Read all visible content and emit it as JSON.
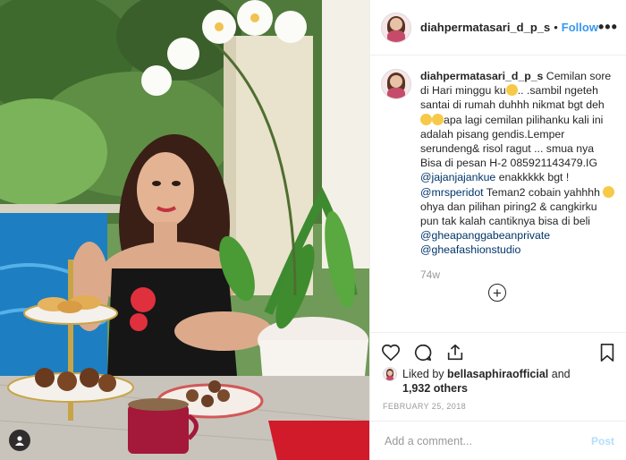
{
  "post": {
    "username": "diahpermatasari_d_p_s",
    "follow_label": "Follow",
    "dot": "•",
    "more_label": "•••"
  },
  "caption": {
    "username": "diahpermatasari_d_p_s",
    "part1": " Cemilan sore di Hari minggu ku",
    "part2": ".. .sambil ngeteh santai di rumah duhhh nikmat bgt deh ",
    "part3": "apa lagi cemilan pilihanku kali ini adalah pisang gendis.Lemper serundeng& risol ragut ... smua nya Bisa di pesan H-2 085921143479.IG ",
    "mention1": "@jajanjajankue",
    "part4": " enakkkkk bgt ! ",
    "mention2": "@mrsperidot",
    "part5": " Teman2 cobain yahhhh ",
    "part6": "ohya dan pilihan piring2 & cangkirku pun tak kalah cantiknya bisa di beli ",
    "mention3": "@gheapanggabeanprivate",
    "mention4": "@gheafashionstudio"
  },
  "time_ago": "74w",
  "load_more": "+",
  "likes": {
    "prefix": "Liked by ",
    "user": "bellasaphiraofficial",
    "middle": " and",
    "count": "1,932 others"
  },
  "date": "February 25, 2018",
  "comment_box": {
    "placeholder": "Add a comment...",
    "post_label": "Post"
  },
  "icons": {
    "like": "heart-icon",
    "comment": "comment-icon",
    "share": "share-icon",
    "save": "bookmark-icon",
    "tag": "user-tag-icon"
  },
  "colors": {
    "link": "#3897f0",
    "mention": "#003569",
    "muted": "#999999",
    "border": "#efefef"
  }
}
